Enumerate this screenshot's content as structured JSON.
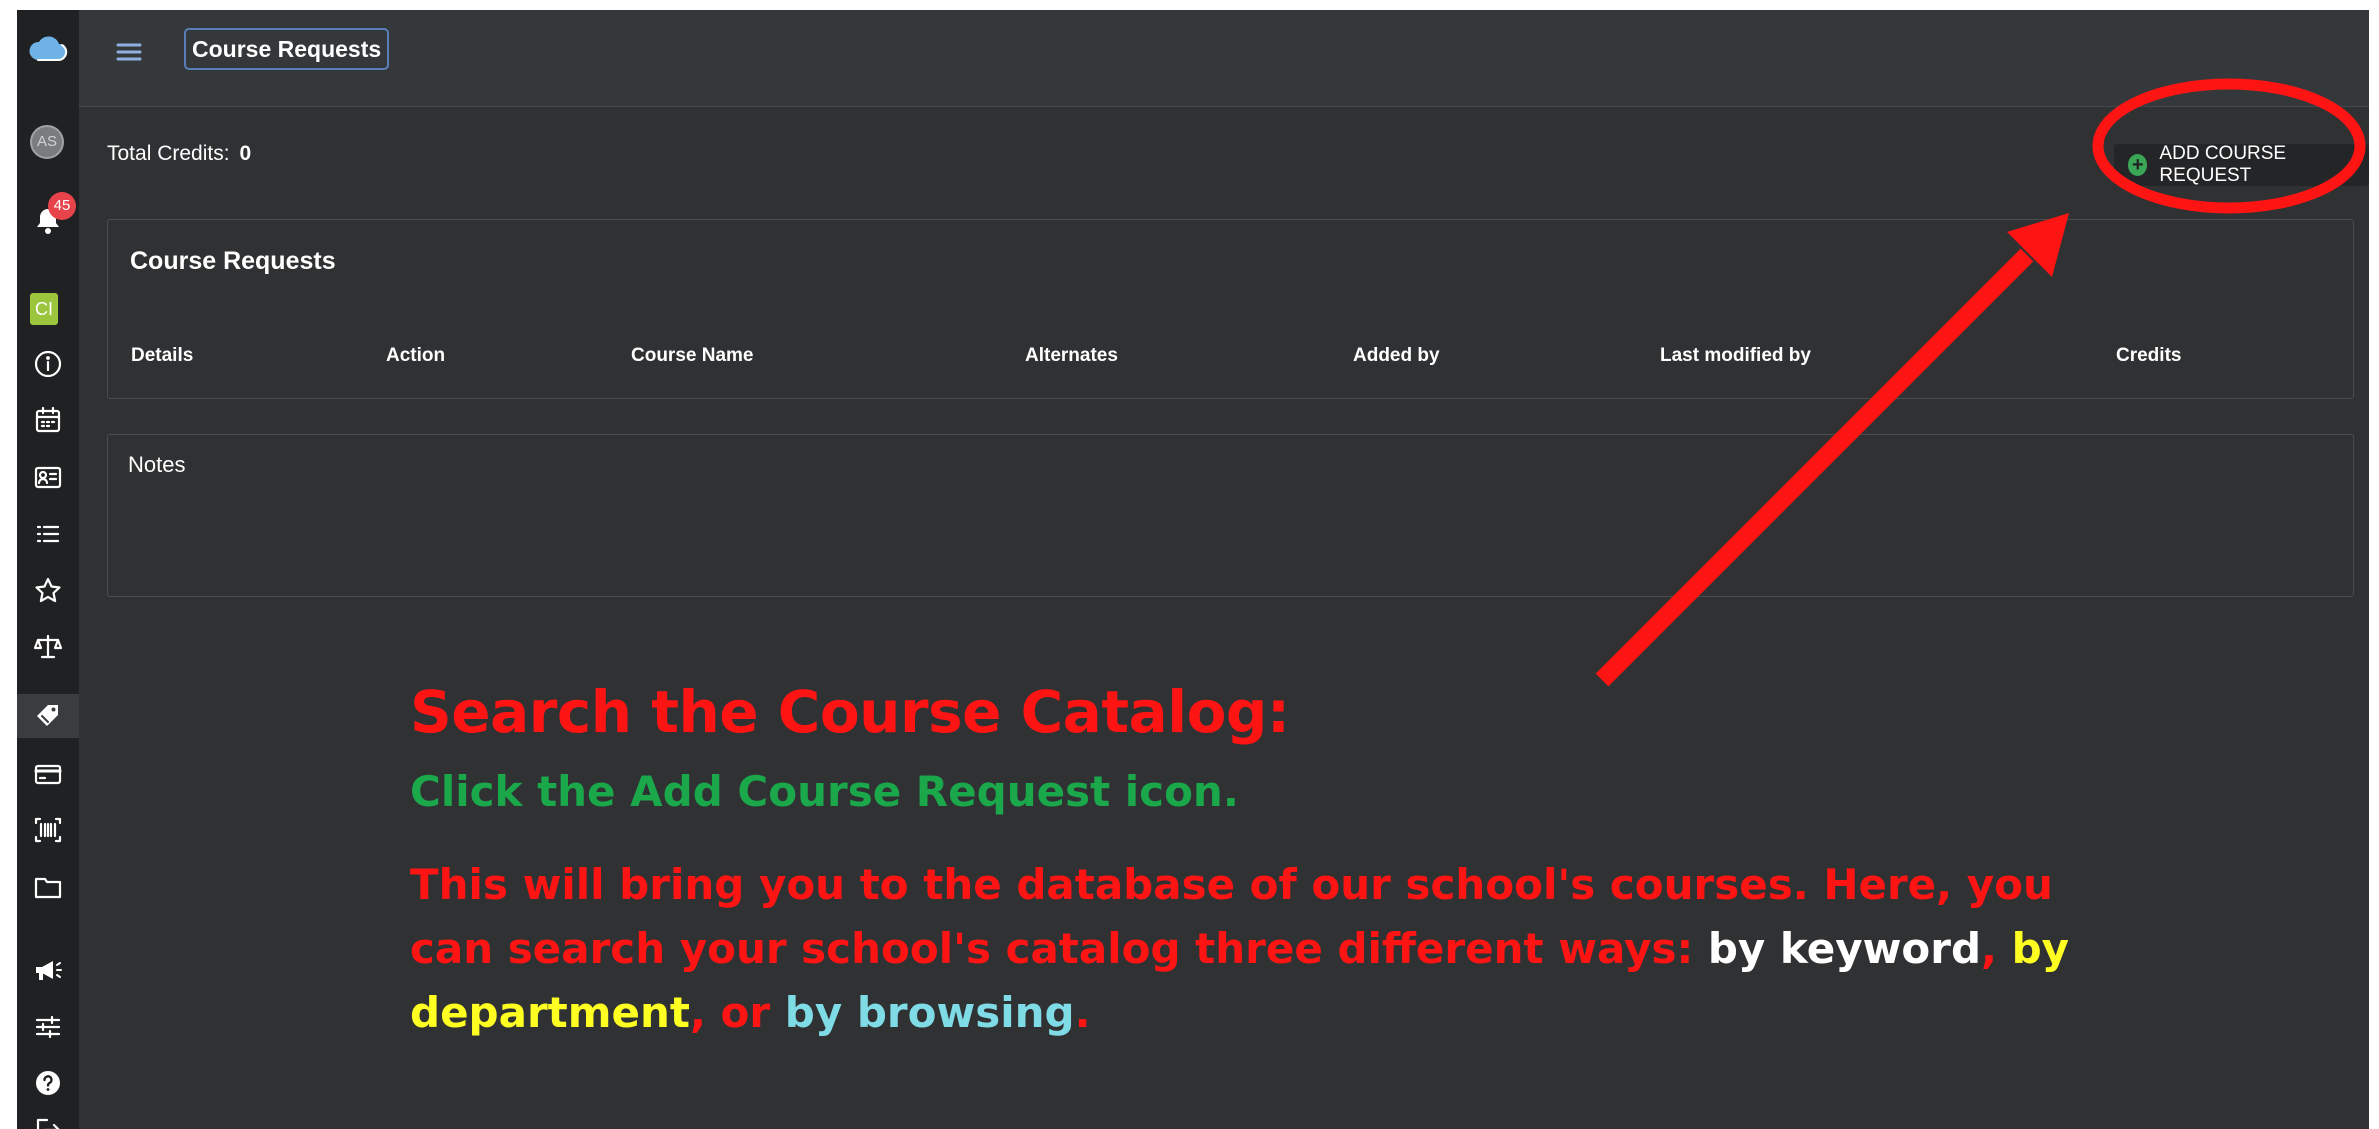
{
  "sidebar": {
    "avatar_initials": "AS",
    "notification_count": "45",
    "ci_badge": "CI",
    "items": [
      {
        "icon": "info-icon"
      },
      {
        "icon": "calendar-icon"
      },
      {
        "icon": "id-card-icon"
      },
      {
        "icon": "list-icon"
      },
      {
        "icon": "star-icon"
      },
      {
        "icon": "scale-icon"
      },
      {
        "icon": "tag-icon"
      },
      {
        "icon": "credit-card-icon"
      },
      {
        "icon": "barcode-icon"
      },
      {
        "icon": "folder-icon"
      },
      {
        "icon": "megaphone-icon"
      },
      {
        "icon": "sliders-icon"
      },
      {
        "icon": "help-icon"
      },
      {
        "icon": "logout-icon"
      }
    ]
  },
  "header": {
    "title": "Course Requests"
  },
  "summary": {
    "total_credits_label": "Total Credits:",
    "total_credits_value": "0"
  },
  "actions": {
    "add_course_request": "ADD COURSE REQUEST"
  },
  "requests_panel": {
    "title": "Course Requests",
    "columns": [
      "Details",
      "Action",
      "Course Name",
      "Alternates",
      "Added by",
      "Last modified by",
      "Credits"
    ]
  },
  "notes_panel": {
    "title": "Notes"
  },
  "annotation": {
    "heading": "Search the Course Catalog:",
    "subheading": "Click the Add Course Request icon.",
    "body_part1": "This will bring you to the database of our school's courses. Here, you can search your school's catalog three different ways: ",
    "keyword": "by keyword",
    "sep1": ", ",
    "department": "by department",
    "sep2": ", or ",
    "browsing": "by browsing",
    "end": "."
  },
  "colors": {
    "annotation_red": "#ff1414",
    "annotation_green": "#1aa84b",
    "annotation_yellow": "#ffff22",
    "annotation_cyan": "#7fdbe6",
    "notification_badge": "#e8434a",
    "ci_badge": "#9bc53d",
    "plus_icon": "#3aa757"
  }
}
